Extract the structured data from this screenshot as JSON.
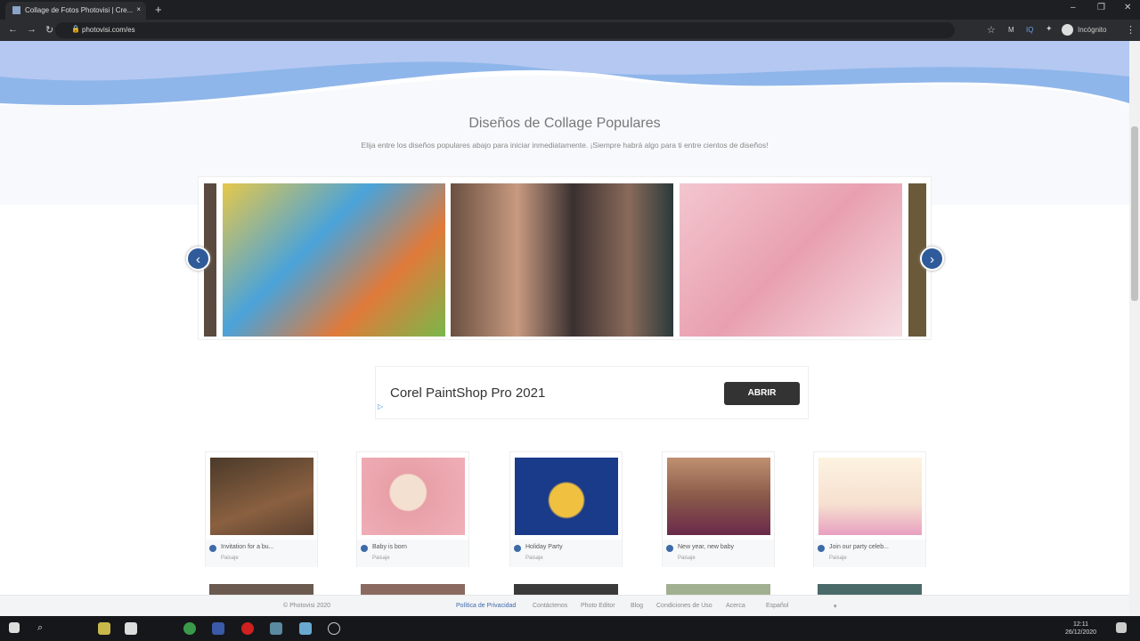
{
  "browser": {
    "tab_title": "Collage de Fotos Photovisi | Cre...",
    "url": "photovisi.com/es",
    "profile": "Incógnito",
    "ext1": "M",
    "ext2": "IQ"
  },
  "page": {
    "title": "Diseños de Collage Populares",
    "subtitle": "Elija entre los diseños populares abajo para iniciar inmediatamente. ¡Siempre habrá algo para ti entre cientos de diseños!"
  },
  "carousel": {
    "prev": "‹",
    "next": "›"
  },
  "ad": {
    "text": "Corel PaintShop Pro 2021",
    "button": "ABRIR"
  },
  "cards": [
    {
      "name": "Invitation for a bu...",
      "tag": "Paisaje"
    },
    {
      "name": "Baby is born",
      "tag": "Paisaje"
    },
    {
      "name": "Holiday Party",
      "tag": "Paisaje"
    },
    {
      "name": "New year, new baby",
      "tag": "Paisaje"
    },
    {
      "name": "Join our party celeb...",
      "tag": "Paisaje"
    }
  ],
  "footer": {
    "copyright": "© Photovisi 2020",
    "links": [
      "Política de Privacidad",
      "Contáctenos",
      "Photo Editor",
      "Blog",
      "Condiciones de Uso",
      "Acerca"
    ],
    "language": "Español"
  },
  "taskbar": {
    "time": "12:11",
    "date": "26/12/2020"
  }
}
